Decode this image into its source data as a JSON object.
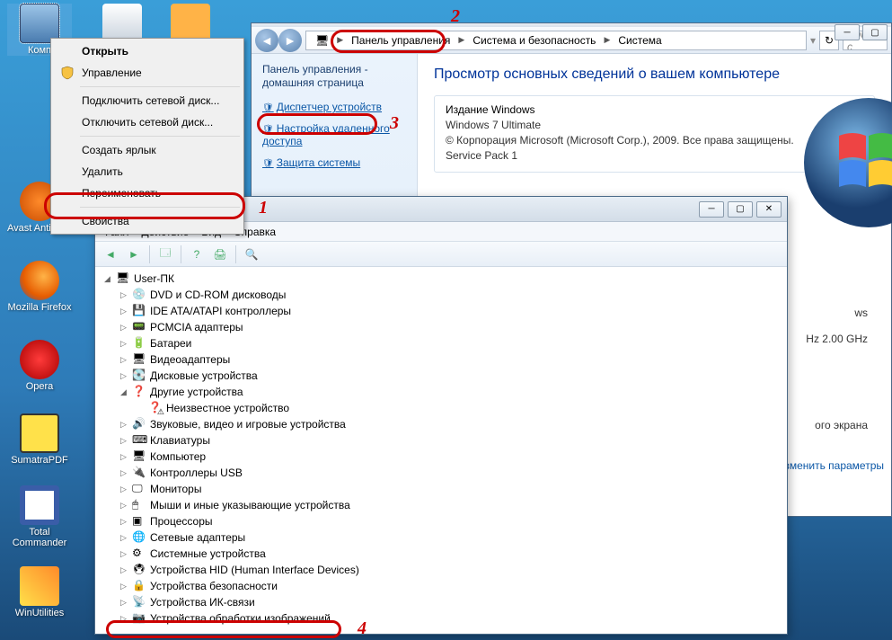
{
  "desktop": {
    "computer": "Комп",
    "avast": "Avast Antivirus",
    "firefox": "Mozilla Firefox",
    "opera": "Opera",
    "sumatra": "SumatraPDF",
    "totalcmd": "Total Commander",
    "winutils": "WinUtilities"
  },
  "ctx": {
    "open": "Открыть",
    "manage": "Управление",
    "map_drive": "Подключить сетевой диск...",
    "unmap_drive": "Отключить сетевой диск...",
    "shortcut": "Создать ярлык",
    "delete": "Удалить",
    "rename": "Переименовать",
    "properties": "Свойства"
  },
  "cp": {
    "breadcrumb": {
      "root": "Панель управления",
      "sec": "Система и безопасность",
      "sys": "Система"
    },
    "search_placeholder": "Поиск с",
    "side": {
      "home": "Панель управления - домашняя страница",
      "devmgr": "Диспетчер устройств",
      "remote": "Настройка удаленного доступа",
      "protect": "Защита системы"
    },
    "main": {
      "title": "Просмотр основных сведений о вашем компьютере",
      "legend": "Издание Windows",
      "edition": "Windows 7 Ultimate",
      "copyright": "© Корпорация Microsoft (Microsoft Corp.), 2009. Все права защищены.",
      "sp": "Service Pack 1",
      "cpu_suffix": "Hz   2.00 GHz",
      "ws_suffix": "ws",
      "screen_suffix": "ого экрана",
      "change": "Изменить параметры"
    }
  },
  "dm": {
    "menu": {
      "file": "Файл",
      "action": "Действие",
      "view": "Вид",
      "help": "Справка"
    },
    "root": "User-ПК",
    "nodes": [
      "DVD и CD-ROM дисководы",
      "IDE ATA/ATAPI контроллеры",
      "PCMCIA адаптеры",
      "Батареи",
      "Видеоадаптеры",
      "Дисковые устройства",
      "Другие устройства",
      "Звуковые, видео и игровые устройства",
      "Клавиатуры",
      "Компьютер",
      "Контроллеры USB",
      "Мониторы",
      "Мыши и иные указывающие устройства",
      "Процессоры",
      "Сетевые адаптеры",
      "Системные устройства",
      "Устройства HID (Human Interface Devices)",
      "Устройства безопасности",
      "Устройства ИК-связи",
      "Устройства обработки изображений"
    ],
    "unknown": "Неизвестное устройство"
  },
  "ann": {
    "n1": "1",
    "n2": "2",
    "n3": "3",
    "n4": "4"
  }
}
